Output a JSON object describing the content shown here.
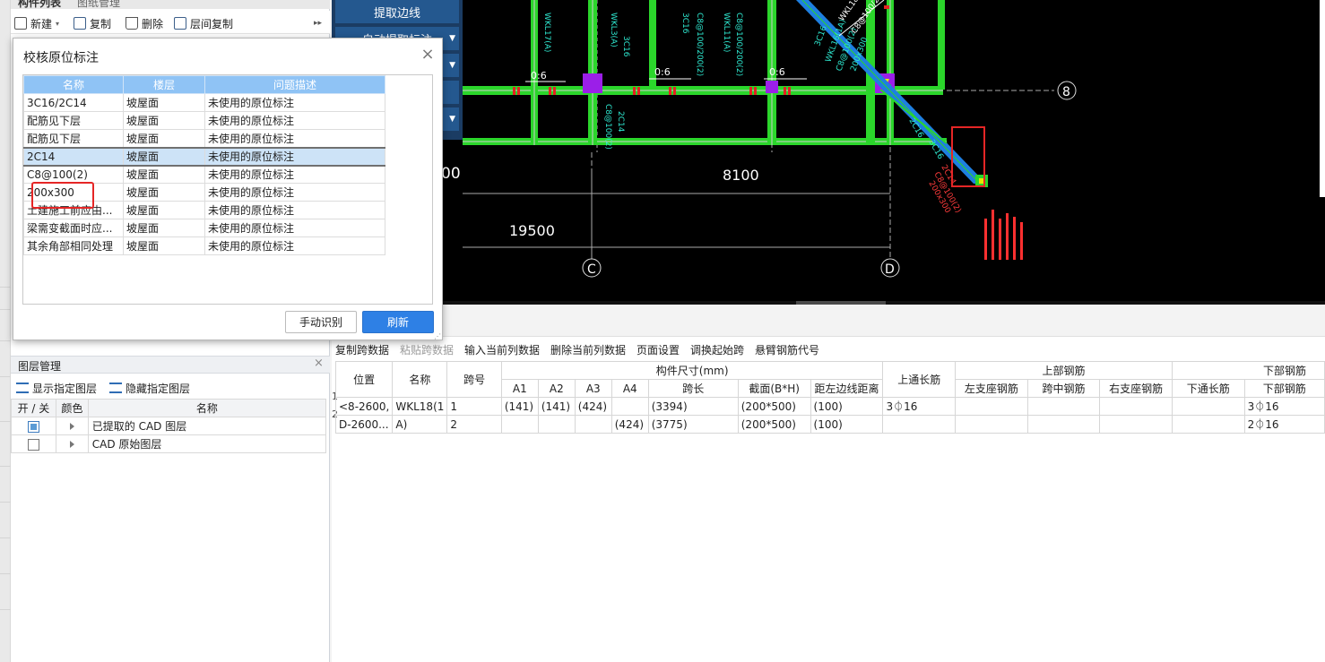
{
  "left_panel": {
    "tabs": [
      "构件列表",
      "图纸管理"
    ],
    "toolbar": {
      "new": "新建",
      "copy": "复制",
      "delete": "删除",
      "floor_copy": "层间复制",
      "more": "▸▸"
    },
    "layer_manager": {
      "title": "图层管理",
      "close": "×",
      "show_btn": "显示指定图层",
      "hide_btn": "隐藏指定图层",
      "columns": [
        "开 / 关",
        "颜色",
        "名称"
      ],
      "rows": [
        {
          "checked": true,
          "name": "已提取的 CAD 图层"
        },
        {
          "checked": false,
          "name": "CAD 原始图层"
        }
      ]
    }
  },
  "ribbon": {
    "btn1": "提取边线",
    "btn2": "自动提取标注"
  },
  "dialog": {
    "title": "校核原位标注",
    "close": "×",
    "columns": [
      "名称",
      "楼层",
      "问题描述"
    ],
    "rows": [
      {
        "name": "3C16/2C14",
        "floor": "坡屋面",
        "desc": "未使用的原位标注"
      },
      {
        "name": "配筋见下层",
        "floor": "坡屋面",
        "desc": "未使用的原位标注"
      },
      {
        "name": "配筋见下层",
        "floor": "坡屋面",
        "desc": "未使用的原位标注"
      },
      {
        "name": "2C14",
        "floor": "坡屋面",
        "desc": "未使用的原位标注"
      },
      {
        "name": "C8@100(2)",
        "floor": "坡屋面",
        "desc": "未使用的原位标注"
      },
      {
        "name": "200x300",
        "floor": "坡屋面",
        "desc": "未使用的原位标注"
      },
      {
        "name": "土建施工前应由...",
        "floor": "坡屋面",
        "desc": "未使用的原位标注"
      },
      {
        "name": "梁需变截面时应...",
        "floor": "坡屋面",
        "desc": "未使用的原位标注"
      },
      {
        "name": "其余角部相同处理",
        "floor": "坡屋面",
        "desc": "未使用的原位标注"
      }
    ],
    "selected_index": 3,
    "btn_manual": "手动识别",
    "btn_refresh": "刷新"
  },
  "cad": {
    "dims": {
      "d1": "8100",
      "d2": "19500",
      "d3": "00"
    },
    "axes": {
      "a8": "8",
      "aC": "C",
      "aD": "D"
    },
    "ratio": [
      "0:6",
      "0:6",
      "0:6"
    ],
    "labels": {
      "w1": "WKL17(A)",
      "w2": "WKL3(A)",
      "w3": "WKL11(A)",
      "w4": "WKL16(1A)",
      "c1": "3C16",
      "c2": "2C14",
      "c3": "C8@100/200(2)",
      "c4": "C8@100(2)",
      "c5": "C8@100(2)",
      "c6": "2C14",
      "c7": "200x300",
      "c8": "3C16",
      "c9": "WKL18(1A) 200*500",
      "c10": "C8@100/200(2) 3C16",
      "c11": "2C16",
      "c12": "2C14",
      "c13": "C8@100(2)",
      "c14": "200x300"
    }
  },
  "right_panel": {
    "toolbar": [
      {
        "label": "复制跨数据",
        "disabled": false
      },
      {
        "label": "粘贴跨数据",
        "disabled": true
      },
      {
        "label": "输入当前列数据",
        "disabled": false
      },
      {
        "label": "删除当前列数据",
        "disabled": false
      },
      {
        "label": "页面设置",
        "disabled": false
      },
      {
        "label": "调换起始跨",
        "disabled": false
      },
      {
        "label": "悬臂钢筋代号",
        "disabled": false
      }
    ],
    "table": {
      "h_position": "位置",
      "h_name": "名称",
      "h_span": "跨号",
      "h_size": "构件尺寸(mm)",
      "h_top_through": "上通长筋",
      "h_top": "上部钢筋",
      "h_bottom": "下部钢筋",
      "sub": [
        "A1",
        "A2",
        "A3",
        "A4",
        "跨长",
        "截面(B*H)",
        "距左边线距离"
      ],
      "top_sub": [
        "左支座钢筋",
        "跨中钢筋",
        "右支座钢筋"
      ],
      "bottom_sub": [
        "下通长筋",
        "下部钢筋"
      ],
      "rows": [
        {
          "num": "1",
          "position": "<8-2600,",
          "name": "WKL18(1",
          "span": "1",
          "a1": "(141)",
          "a2": "(141)",
          "a3": "(424)",
          "a4": "",
          "len": "(3394)",
          "sec": "(200*500)",
          "dist": "(100)",
          "top_through": "3⏀16",
          "bottom": "3⏀16"
        },
        {
          "num": "2",
          "position": "D-2600...",
          "name": "A)",
          "span": "2",
          "a1": "",
          "a2": "",
          "a3": "",
          "a4": "(424)",
          "len": "(3775)",
          "sec": "(200*500)",
          "dist": "(100)",
          "top_through": "",
          "bottom": "2⏀16"
        }
      ]
    }
  },
  "colors": {
    "accent": "#2e80e5",
    "header_blue": "#8fc3f5",
    "ribbon": "#1b3c63",
    "highlight_red": "#e52626"
  }
}
